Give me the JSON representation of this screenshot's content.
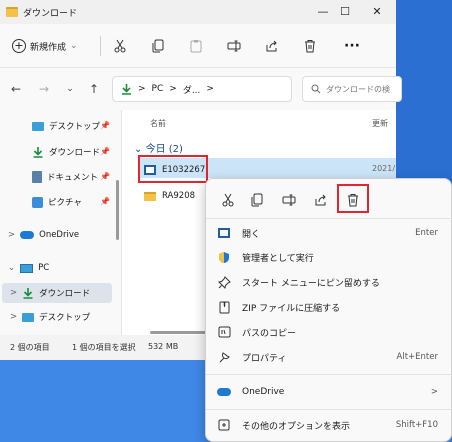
{
  "window": {
    "title": "ダウンロード"
  },
  "window_controls": {
    "minimize": "—",
    "maximize": "☐",
    "close": "✕"
  },
  "toolbar": {
    "new_label": "新規作成",
    "new_chevron": "⌄",
    "more": "···"
  },
  "nav": {
    "back": "←",
    "forward": "→",
    "recent": "⌄",
    "up": "↑",
    "breadcrumb": [
      "PC",
      "ダ..."
    ],
    "sep": ">",
    "search_placeholder": "ダウンロードの検"
  },
  "sidebar": {
    "quick": [
      {
        "label": "デスクトップ",
        "icon": "desktop-icon"
      },
      {
        "label": "ダウンロード",
        "icon": "download-icon"
      },
      {
        "label": "ドキュメント",
        "icon": "document-icon"
      },
      {
        "label": "ピクチャ",
        "icon": "picture-icon"
      }
    ],
    "pin": "📌",
    "expander": ">",
    "expander_open": "⌄",
    "onedrive": "OneDrive",
    "pc": "PC",
    "pc_children": [
      "ダウンロード",
      "デスクトップ"
    ]
  },
  "content": {
    "col_name": "名前",
    "col_updated": "更新",
    "group": "今日 (2)",
    "group_chevron": "⌄",
    "files": [
      {
        "name": "E1032267",
        "type": "exe",
        "date": "2021/"
      },
      {
        "name": "RA9208",
        "type": "folder"
      }
    ]
  },
  "status": {
    "count": "2 個の項目",
    "selected": "1 個の項目を選択",
    "size": "532 MB"
  },
  "context_menu": {
    "items": [
      {
        "label": "開く",
        "key": "Enter",
        "icon": "open-icon"
      },
      {
        "label": "管理者として実行",
        "key": "",
        "icon": "shield-icon"
      },
      {
        "label": "スタート メニューにピン留めする",
        "key": "",
        "icon": "pin-icon"
      },
      {
        "label": "ZIP ファイルに圧縮する",
        "key": "",
        "icon": "zip-icon"
      },
      {
        "label": "パスのコピー",
        "key": "",
        "icon": "copy-path-icon"
      },
      {
        "label": "プロパティ",
        "key": "Alt+Enter",
        "icon": "properties-icon"
      }
    ],
    "onedrive": {
      "label": "OneDrive",
      "arrow": ">"
    },
    "more": {
      "label": "その他のオプションを表示",
      "key": "Shift+F10"
    }
  },
  "colors": {
    "accent": "#0067c0",
    "highlight": "#e0262e",
    "selection": "#cce4f7"
  }
}
